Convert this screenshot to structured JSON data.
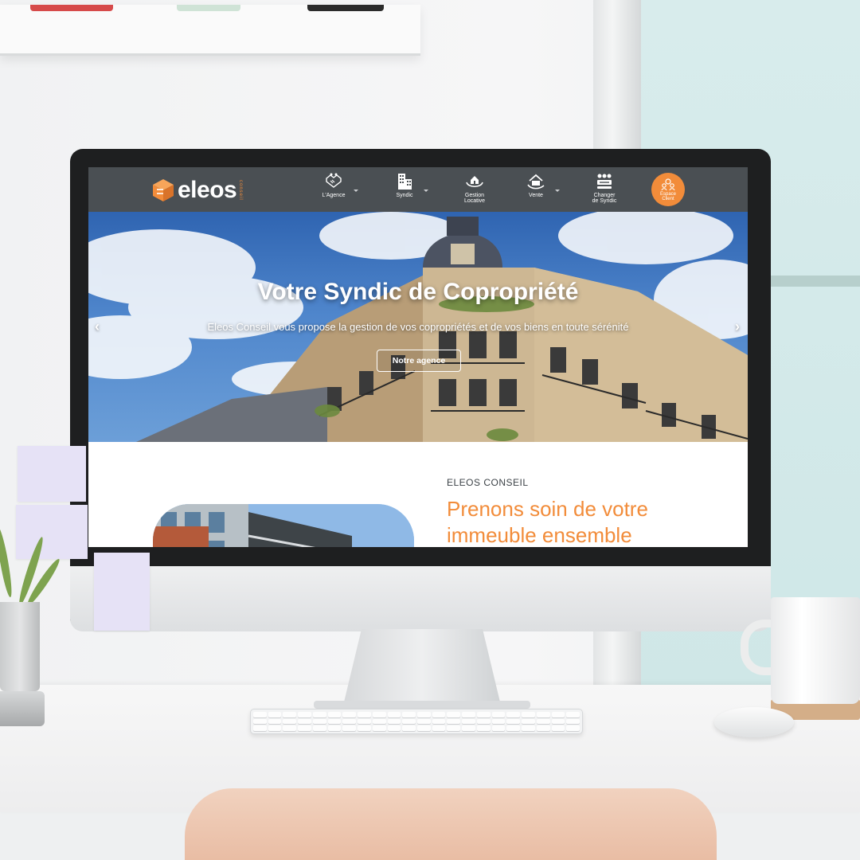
{
  "brand": {
    "logo_text": "eleos",
    "logo_sub": "conseil",
    "accent_color": "#f28c3a",
    "nav_bg_color": "#4a4f53"
  },
  "nav": {
    "items": [
      {
        "label": "L'Agence",
        "icon": "handshake-icon"
      },
      {
        "label": "Syndic",
        "icon": "building-icon"
      },
      {
        "label": "Gestion\nLocative",
        "icon": "house-hand-icon"
      },
      {
        "label": "Vente",
        "icon": "house-sale-icon"
      },
      {
        "label": "Changer\nde Syndic",
        "icon": "swap-icon"
      }
    ],
    "espace_client": {
      "label": "Espace\nClient",
      "icon": "users-icon"
    }
  },
  "hero": {
    "title": "Votre Syndic de Copropriété",
    "subtitle": "Eleos Conseil vous propose la gestion de vos copropriétés et de vos biens en toute sérénité",
    "button": "Notre agence",
    "prev_arrow": "‹",
    "next_arrow": "›"
  },
  "section": {
    "eyebrow": "ELEOS CONSEIL",
    "headline": "Prenons soin de votre immeuble ensemble"
  }
}
